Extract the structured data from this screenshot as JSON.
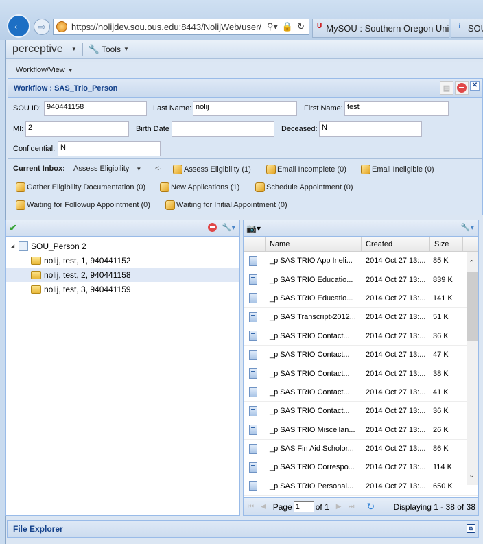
{
  "browser": {
    "url": "https://nolijdev.sou.ous.edu:8443/NolijWeb/user/",
    "tabs": [
      {
        "label": "MySOU : Southern Oregon Uni..."
      },
      {
        "label": "SOU"
      }
    ]
  },
  "topbar": {
    "brand": "perceptive",
    "tools": "Tools"
  },
  "menubar": {
    "workflow_view": "Workflow/View"
  },
  "workflow": {
    "title": "Workflow : SAS_Trio_Person",
    "fields": {
      "sou_id_label": "SOU ID:",
      "sou_id": "940441158",
      "last_name_label": "Last Name:",
      "last_name": "nolij",
      "first_name_label": "First Name:",
      "first_name": "test",
      "mi_label": "MI:",
      "mi": "2",
      "birth_date_label": "Birth Date",
      "birth_date": "",
      "deceased_label": "Deceased:",
      "deceased": "N",
      "confidential_label": "Confidential:",
      "confidential": "N"
    }
  },
  "inbox": {
    "label": "Current Inbox:",
    "current": "Assess Eligibility",
    "collapse": "<·",
    "items": [
      "Assess Eligibility (1)",
      "Email Incomplete (0)",
      "Email Ineligible (0)",
      "Gather Eligibility Documentation (0)",
      "New Applications (1)",
      "Schedule Appointment (0)",
      "Waiting for Followup Appointment (0)",
      "Waiting for Initial Appointment (0)"
    ]
  },
  "tree": {
    "root": "SOU_Person 2",
    "children": [
      "nolij, test, 1, 940441152",
      "nolij, test, 2, 940441158",
      "nolij, test, 3, 940441159"
    ],
    "selected_index": 1
  },
  "grid": {
    "columns": [
      "Name",
      "Created",
      "Size"
    ],
    "rows": [
      {
        "name": "_p SAS TRIO App Ineli...",
        "created": "2014 Oct 27 13:...",
        "size": "85 K"
      },
      {
        "name": "_p SAS TRIO Educatio...",
        "created": "2014 Oct 27 13:...",
        "size": "839 K"
      },
      {
        "name": "_p SAS TRIO Educatio...",
        "created": "2014 Oct 27 13:...",
        "size": "141 K"
      },
      {
        "name": "_p SAS Transcript-2012...",
        "created": "2014 Oct 27 13:...",
        "size": "51 K"
      },
      {
        "name": "_p SAS TRIO Contact...",
        "created": "2014 Oct 27 13:...",
        "size": "36 K"
      },
      {
        "name": "_p SAS TRIO Contact...",
        "created": "2014 Oct 27 13:...",
        "size": "47 K"
      },
      {
        "name": "_p SAS TRIO Contact...",
        "created": "2014 Oct 27 13:...",
        "size": "38 K"
      },
      {
        "name": "_p SAS TRIO Contact...",
        "created": "2014 Oct 27 13:...",
        "size": "41 K"
      },
      {
        "name": "_p SAS TRIO Contact...",
        "created": "2014 Oct 27 13:...",
        "size": "36 K"
      },
      {
        "name": "_p SAS TRIO Miscellan...",
        "created": "2014 Oct 27 13:...",
        "size": "26 K"
      },
      {
        "name": "_p SAS Fin Aid Scholor...",
        "created": "2014 Oct 27 13:...",
        "size": "86 K"
      },
      {
        "name": "_p SAS TRIO Correspo...",
        "created": "2014 Oct 27 13:...",
        "size": "114 K"
      },
      {
        "name": "_p SAS TRIO Personal...",
        "created": "2014 Oct 27 13:...",
        "size": "650 K"
      }
    ]
  },
  "pager": {
    "page_label": "Page",
    "page": "1",
    "of": "of 1",
    "display": "Displaying 1 - 38 of 38"
  },
  "footer": {
    "title": "File Explorer"
  }
}
